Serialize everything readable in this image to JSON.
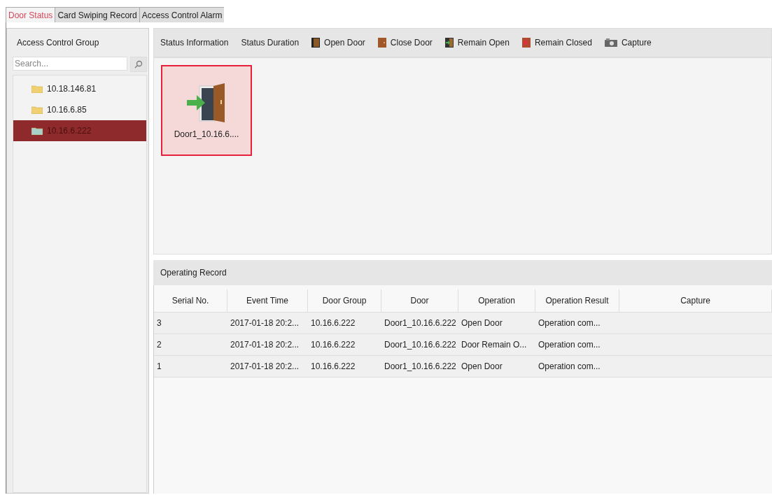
{
  "tabs": [
    {
      "label": "Door Status",
      "selected": true
    },
    {
      "label": "Card Swiping Record",
      "selected": false
    },
    {
      "label": "Access Control Alarm",
      "selected": false
    }
  ],
  "sidebar": {
    "title": "Access Control Group",
    "search": {
      "placeholder": "Search..."
    },
    "items": [
      {
        "label": "10.18.146.81",
        "selected": false
      },
      {
        "label": "10.16.6.85",
        "selected": false
      },
      {
        "label": "10.16.6.222",
        "selected": true
      }
    ]
  },
  "toolbar": [
    {
      "kind": "text",
      "label": "Status Information"
    },
    {
      "kind": "text",
      "label": "Status Duration"
    },
    {
      "kind": "open",
      "label": "Open Door"
    },
    {
      "kind": "close",
      "label": "Close Door"
    },
    {
      "kind": "remain-open",
      "label": "Remain Open"
    },
    {
      "kind": "remain-closed",
      "label": "Remain Closed"
    },
    {
      "kind": "capture",
      "label": "Capture"
    }
  ],
  "doors": [
    {
      "label": "Door1_10.16.6....",
      "selected": true
    }
  ],
  "operating_record": {
    "title": "Operating Record",
    "columns": [
      "Serial No.",
      "Event Time",
      "Door Group",
      "Door",
      "Operation",
      "Operation Result",
      "Capture"
    ],
    "rows": [
      [
        "3",
        "2017-01-18 20:2...",
        "10.16.6.222",
        "Door1_10.16.6.222",
        "Open Door",
        "Operation com...",
        ""
      ],
      [
        "2",
        "2017-01-18 20:2...",
        "10.16.6.222",
        "Door1_10.16.6.222",
        "Door Remain O...",
        "Operation com...",
        ""
      ],
      [
        "1",
        "2017-01-18 20:2...",
        "10.16.6.222",
        "Door1_10.16.6.222",
        "Open Door",
        "Operation com...",
        ""
      ]
    ]
  }
}
